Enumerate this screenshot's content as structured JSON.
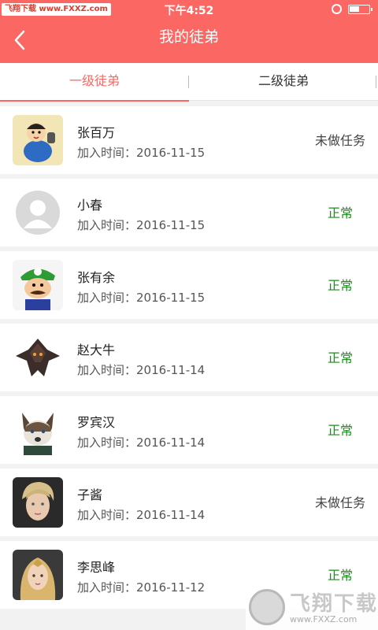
{
  "status_bar": {
    "watermark": "飞翔下载 www.FXXZ.com",
    "time": "下午4:52"
  },
  "header": {
    "title": "我的徒弟"
  },
  "tabs": [
    {
      "label": "一级徒弟"
    },
    {
      "label": "二级徒弟"
    }
  ],
  "rows": [
    {
      "name": "张百万",
      "join_label": "加入时间：",
      "date": "2016-11-15",
      "status": "未做任务",
      "avatar": "cartoon-boy-avatar"
    },
    {
      "name": "小春",
      "join_label": "加入时间：",
      "date": "2016-11-15",
      "status": "正常",
      "avatar": "default-user-avatar"
    },
    {
      "name": "张有余",
      "join_label": "加入时间：",
      "date": "2016-11-15",
      "status": "正常",
      "avatar": "mario-avatar"
    },
    {
      "name": "赵大牛",
      "join_label": "加入时间：",
      "date": "2016-11-14",
      "status": "正常",
      "avatar": "dragon-avatar"
    },
    {
      "name": "罗宾汉",
      "join_label": "加入时间：",
      "date": "2016-11-14",
      "status": "正常",
      "avatar": "wolf-avatar"
    },
    {
      "name": "子酱",
      "join_label": "加入时间：",
      "date": "2016-11-14",
      "status": "未做任务",
      "avatar": "young-man-avatar"
    },
    {
      "name": "李思峰",
      "join_label": "加入时间：",
      "date": "2016-11-12",
      "status": "正常",
      "avatar": "girl-avatar"
    }
  ],
  "watermark": {
    "text": "飞翔下载",
    "url": "www.FXXZ.com"
  },
  "colors": {
    "accent": "#fb6763",
    "status_normal": "#1f8a1f",
    "status_pending": "#444444"
  }
}
